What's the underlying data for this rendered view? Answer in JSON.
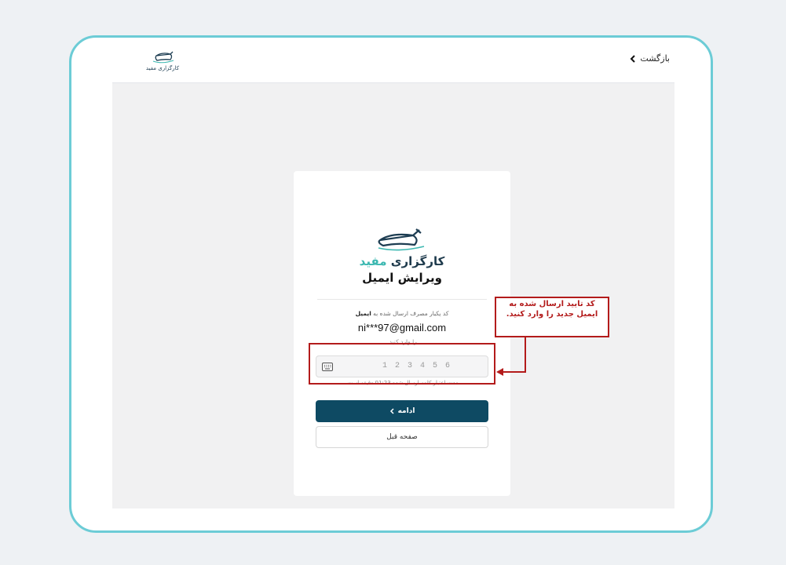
{
  "header": {
    "back_label": "بازگشت",
    "logo_text": "کارگزاری مفید"
  },
  "card": {
    "logo": {
      "main": "کارگزاری",
      "accent": "مفید"
    },
    "title": "ویرایش ایمیل",
    "description_prefix": "کد یکبار مصرف ارسال شده به",
    "description_bold": "ایمیل",
    "email": "ni***97@gmail.com",
    "description_suffix": "را وارد کنید.",
    "otp_placeholder": "1 2 3 4 5 6",
    "timer_text": "مدت اعتبار کلمه ارسال شده 01:23 دقیقه است.",
    "continue_label": "ادامه",
    "previous_label": "صفحه قبل"
  },
  "annotation": {
    "callout_text": "کد تایید ارسال شده به ایمیل جدید را وارد کنید."
  },
  "colors": {
    "frame_border": "#6cccd6",
    "primary_button": "#0e4a63",
    "annotation_red": "#b31b1b",
    "brand_accent": "#3cb8b1"
  },
  "icons": [
    "chevron-left-icon",
    "logo-bull-icon",
    "keyboard-icon"
  ]
}
